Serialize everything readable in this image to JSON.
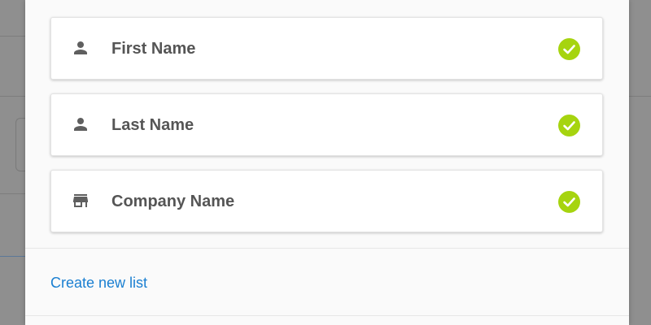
{
  "fields": [
    {
      "label": "First Name",
      "icon": "person-icon",
      "status": "selected"
    },
    {
      "label": "Last Name",
      "icon": "person-icon",
      "status": "selected"
    },
    {
      "label": "Company Name",
      "icon": "store-icon",
      "status": "selected"
    }
  ],
  "footer": {
    "create_link": "Create new list"
  },
  "colors": {
    "check": "#a6d40f",
    "icon": "#5f5f5f",
    "label": "#555555",
    "link": "#1a7fd1",
    "overlay": "#8f8f8f"
  }
}
